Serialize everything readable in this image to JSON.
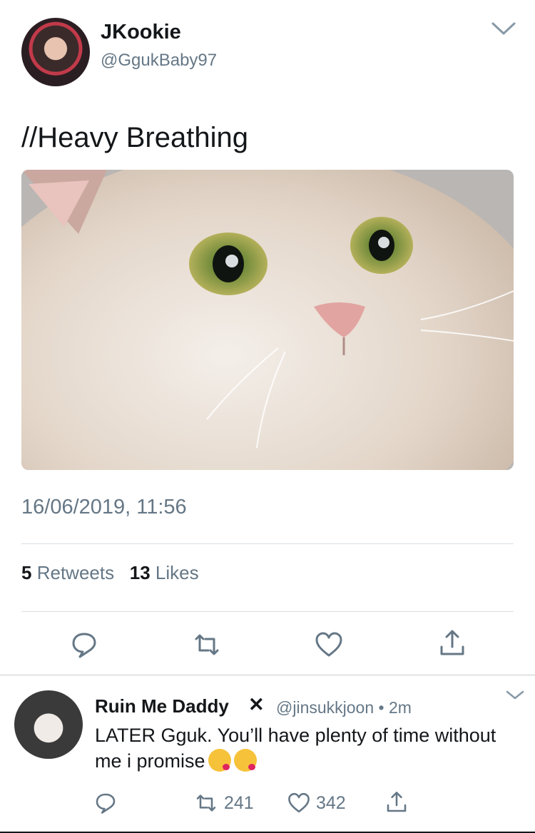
{
  "author": {
    "name": "JKookie",
    "handle": "@GgukBaby97"
  },
  "tweet": {
    "text": "//Heavy Breathing",
    "timestamp": "16/06/2019, 11:56",
    "retweets_count": "5",
    "retweets_label": "Retweets",
    "likes_count": "13",
    "likes_label": "Likes"
  },
  "actions": [
    "reply-icon",
    "retweet-icon",
    "like-icon",
    "share-icon"
  ],
  "reply": {
    "name": "Ruin Me Daddy",
    "x_mark": "✕",
    "handle": "@jinsukkjoon",
    "dot": "•",
    "time": "2m",
    "text": "LATER Gguk. You’ll have plenty of time without me i promise",
    "retweets": "241",
    "likes": "342"
  },
  "colors": {
    "text": "#14171a",
    "secondary": "#657786",
    "divider": "#d9dee2",
    "icon": "#657786"
  }
}
